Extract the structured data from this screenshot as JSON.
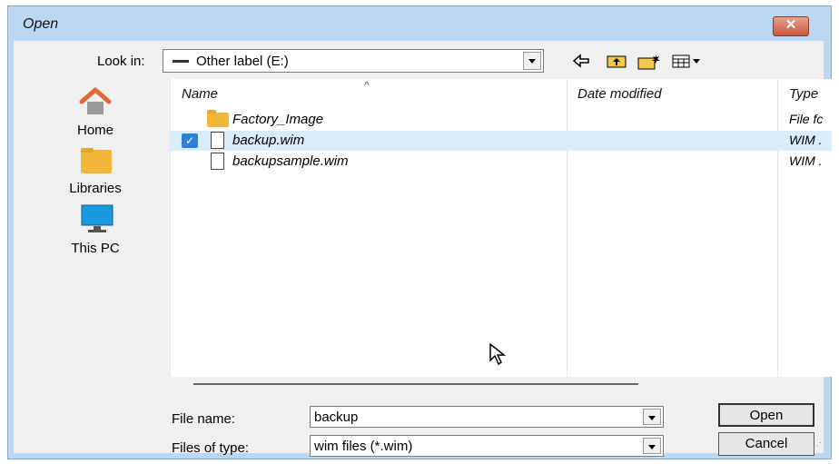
{
  "window": {
    "title": "Open",
    "close_glyph": "✕"
  },
  "toolbar": {
    "look_in_label": "Look in:",
    "look_in_value": "Other label (E:)",
    "icons": [
      "back-arrow-icon",
      "up-folder-icon",
      "new-folder-icon",
      "view-menu-icon"
    ]
  },
  "places": [
    {
      "label": "Home",
      "icon": "home-icon"
    },
    {
      "label": "Libraries",
      "icon": "libraries-icon"
    },
    {
      "label": "This PC",
      "icon": "this-pc-icon"
    }
  ],
  "filelist": {
    "columns": [
      "Name",
      "Date modified",
      "Type"
    ],
    "rows": [
      {
        "name": "Factory_Image",
        "type": "File fc",
        "icon": "folder-icon",
        "selected": false
      },
      {
        "name": "backup.wim",
        "type": "WIM .",
        "icon": "file-icon",
        "selected": true
      },
      {
        "name": "backupsample.wim",
        "type": "WIM .",
        "icon": "file-icon",
        "selected": false
      }
    ]
  },
  "form": {
    "file_name_label": "File name:",
    "file_name_value": "backup",
    "files_of_type_label": "Files of type:",
    "files_of_type_value": "wim files (*.wim)",
    "open_label": "Open",
    "cancel_label": "Cancel"
  },
  "colors": {
    "titlebar": "#bcd7f2",
    "selection": "#d8ecf9",
    "folder": "#f2b63b",
    "close": "#c7573c"
  }
}
